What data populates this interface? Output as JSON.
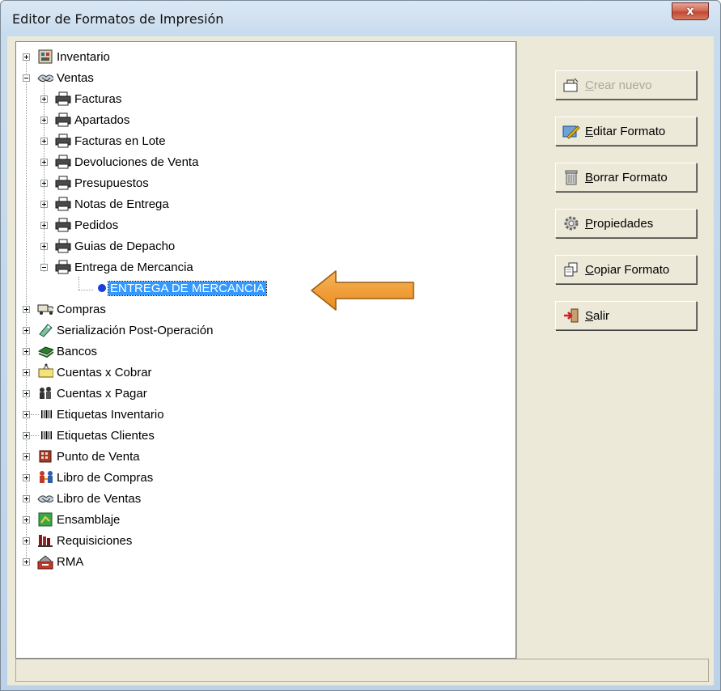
{
  "window": {
    "title": "Editor de Formatos de Impresión",
    "close_label": "x"
  },
  "tree": {
    "root_items": [
      {
        "label": "Inventario",
        "icon": "inventory-icon"
      },
      {
        "label": "Ventas",
        "icon": "handshake-icon"
      },
      {
        "label": "Compras",
        "icon": "truck-icon"
      },
      {
        "label": "Serialización Post-Operación",
        "icon": "serial-tag-icon"
      },
      {
        "label": "Bancos",
        "icon": "money-icon"
      },
      {
        "label": "Cuentas x Cobrar",
        "icon": "receivable-box-icon"
      },
      {
        "label": "Cuentas x Pagar",
        "icon": "payable-icon"
      },
      {
        "label": "Etiquetas Inventario",
        "icon": "barcode-icon"
      },
      {
        "label": "Etiquetas Clientes",
        "icon": "barcode-icon"
      },
      {
        "label": "Punto de Venta",
        "icon": "cash-register-icon"
      },
      {
        "label": "Libro de Compras",
        "icon": "purchase-book-icon"
      },
      {
        "label": "Libro de Ventas",
        "icon": "handshake-icon"
      },
      {
        "label": "Ensamblaje",
        "icon": "assembly-icon"
      },
      {
        "label": "Requisiciones",
        "icon": "requisition-icon"
      },
      {
        "label": "RMA",
        "icon": "rma-icon"
      }
    ],
    "ventas_children": [
      {
        "label": "Facturas"
      },
      {
        "label": "Apartados"
      },
      {
        "label": "Facturas en Lote"
      },
      {
        "label": "Devoluciones de Venta"
      },
      {
        "label": "Presupuestos"
      },
      {
        "label": "Notas de Entrega"
      },
      {
        "label": "Pedidos"
      },
      {
        "label": "Guias de Depacho"
      },
      {
        "label": "Entrega de Mercancia"
      }
    ],
    "selected_leaf": "ENTREGA DE MERCANCIA"
  },
  "buttons": {
    "crear": {
      "u": "C",
      "rest": "rear nuevo"
    },
    "editar": {
      "u": "E",
      "rest": "ditar Formato"
    },
    "borrar": {
      "u": "B",
      "rest": "orrar Formato"
    },
    "propiedades": {
      "u": "P",
      "rest": "ropiedades"
    },
    "copiar": {
      "u": "C",
      "rest": "opiar Formato"
    },
    "salir": {
      "u": "S",
      "rest": "alir"
    }
  },
  "colors": {
    "selection": "#3399ff",
    "arrow": "#f39c2c",
    "face": "#ece9d8"
  }
}
